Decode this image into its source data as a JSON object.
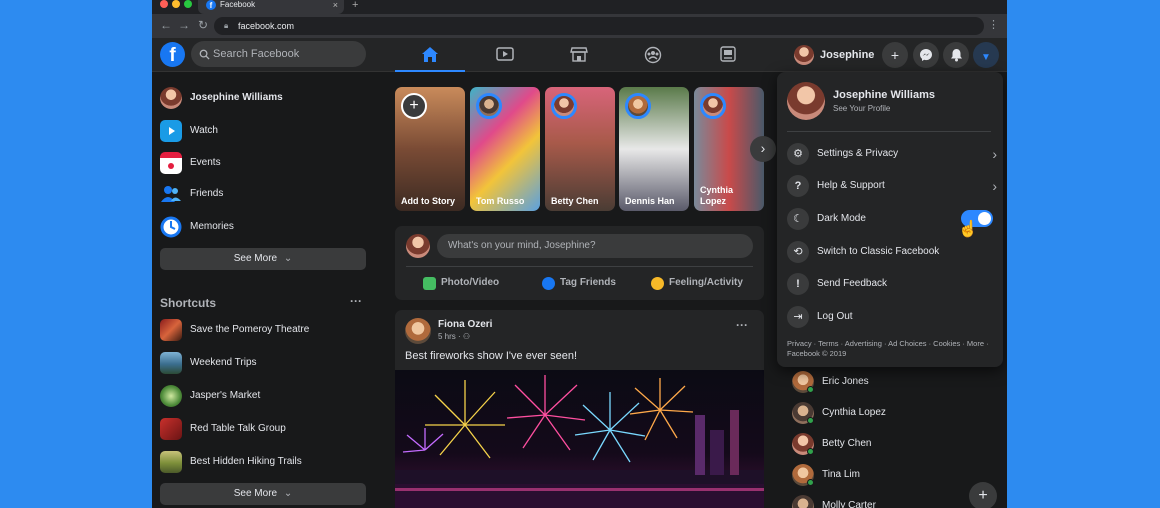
{
  "browser": {
    "tab_title": "Facebook",
    "tab_favicon": "f",
    "close": "×",
    "new_tab": "+",
    "url": "facebook.com"
  },
  "header": {
    "logo": "f",
    "search_placeholder": "Search Facebook",
    "profile_name": "Josephine"
  },
  "sidebar": {
    "items": [
      {
        "label": "Josephine Williams"
      },
      {
        "label": "Watch"
      },
      {
        "label": "Events"
      },
      {
        "label": "Friends"
      },
      {
        "label": "Memories"
      }
    ],
    "see_more": "See More",
    "shortcuts_title": "Shortcuts",
    "shortcuts": [
      {
        "label": "Save the Pomeroy Theatre"
      },
      {
        "label": "Weekend Trips"
      },
      {
        "label": "Jasper's Market"
      },
      {
        "label": "Red Table Talk Group"
      },
      {
        "label": "Best Hidden Hiking Trails"
      }
    ],
    "see_more_2": "See More"
  },
  "stories": [
    {
      "name": "Add to Story"
    },
    {
      "name": "Tom Russo"
    },
    {
      "name": "Betty Chen"
    },
    {
      "name": "Dennis Han"
    },
    {
      "name": "Cynthia Lopez"
    }
  ],
  "composer": {
    "placeholder": "What's on your mind, Josephine?",
    "actions": [
      {
        "label": "Photo/Video"
      },
      {
        "label": "Tag Friends"
      },
      {
        "label": "Feeling/Activity"
      }
    ]
  },
  "post": {
    "author": "Fiona Ozeri",
    "time": "5 hrs ·",
    "text": "Best fireworks show I've ever seen!"
  },
  "menu": {
    "profile_name": "Josephine Williams",
    "profile_sub": "See Your Profile",
    "items": [
      {
        "label": "Settings & Privacy"
      },
      {
        "label": "Help & Support"
      },
      {
        "label": "Dark Mode"
      },
      {
        "label": "Switch to Classic Facebook"
      },
      {
        "label": "Send Feedback"
      },
      {
        "label": "Log Out"
      }
    ],
    "dark_mode_on": true,
    "footer": "Privacy · Terms · Advertising · Ad Choices · Cookies · More · Facebook © 2019"
  },
  "contacts": [
    {
      "name": "Eric Jones"
    },
    {
      "name": "Cynthia Lopez"
    },
    {
      "name": "Betty Chen"
    },
    {
      "name": "Tina Lim"
    },
    {
      "name": "Molly Carter"
    }
  ],
  "colors": {
    "accent": "#2d88ff",
    "background": "#18191a",
    "surface": "#242526",
    "desktop": "#2d8bf0"
  }
}
